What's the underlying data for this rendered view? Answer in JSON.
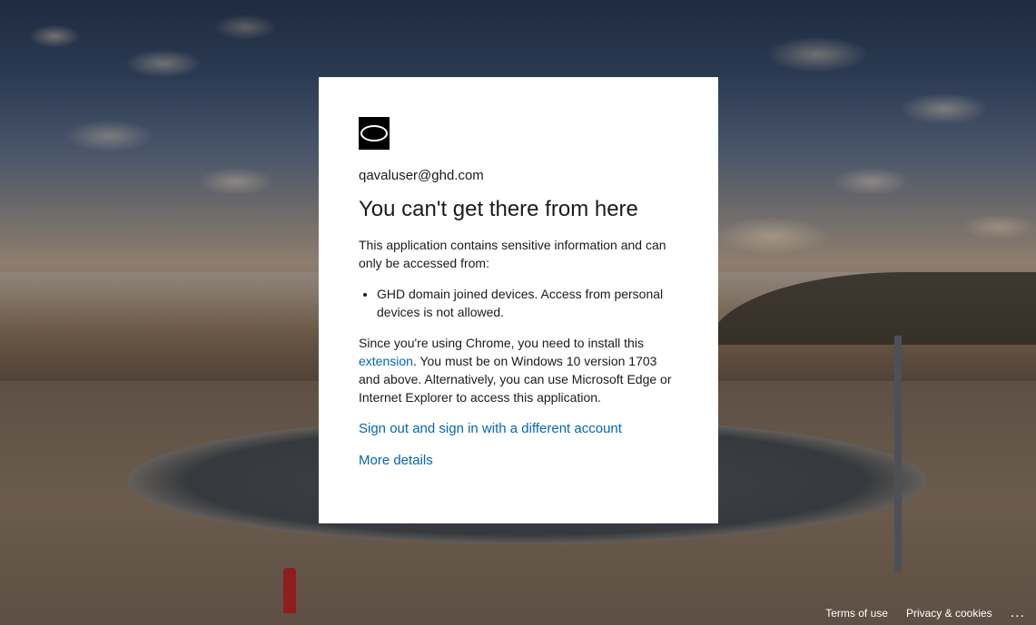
{
  "identity": {
    "email": "qavaluser@ghd.com"
  },
  "logo": {
    "icon": "ghd-logo-icon"
  },
  "error": {
    "title": "You can't get there from here",
    "intro": "This application contains sensitive information and can only be accessed from:",
    "requirements": [
      "GHD domain joined devices. Access from personal devices is not allowed."
    ],
    "chrome_text_before": "Since you're using Chrome, you need to install this ",
    "chrome_link": "extension",
    "chrome_text_after": ". You must be on Windows 10 version 1703 and above. Alternatively, you can use Microsoft Edge or Internet Explorer to access this application."
  },
  "actions": {
    "sign_out": "Sign out and sign in with a different account",
    "more_details": "More details"
  },
  "footer": {
    "terms": "Terms of use",
    "privacy": "Privacy & cookies",
    "more": "..."
  },
  "colors": {
    "link": "#0067b8",
    "card_bg": "#ffffff",
    "text": "#1b1b1b"
  }
}
